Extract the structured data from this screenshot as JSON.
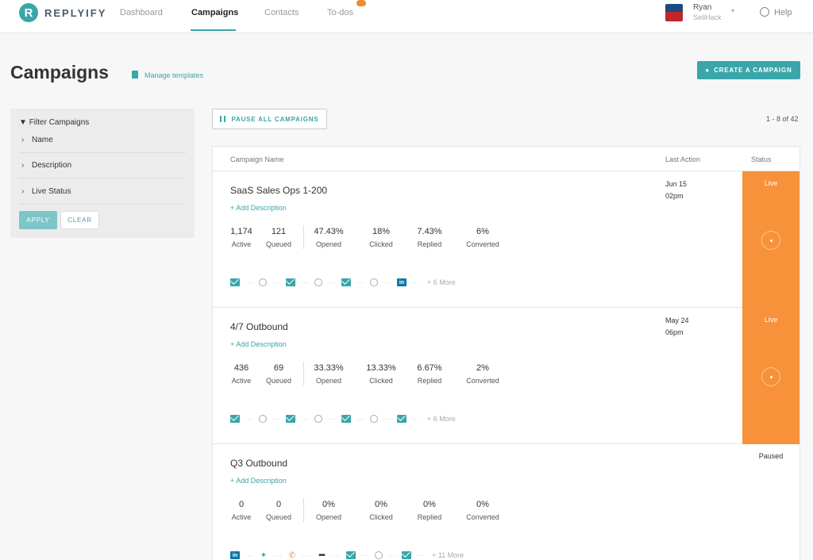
{
  "nav": {
    "brand": "REPLYIFY",
    "brand_mark": "R",
    "items": [
      "Dashboard",
      "Campaigns",
      "Contacts",
      "To-dos"
    ],
    "user_name": "Ryan",
    "user_org": "SellHack",
    "help": "Help"
  },
  "header": {
    "title": "Campaigns",
    "manage_templates": "Manage templates",
    "create_button": "CREATE A CAMPAIGN"
  },
  "filter": {
    "title": "Filter Campaigns",
    "rows": [
      "Name",
      "Description",
      "Live Status"
    ],
    "apply": "APPLY",
    "clear": "CLEAR"
  },
  "toolbar": {
    "pause_all": "PAUSE ALL CAMPAIGNS",
    "pagination": "1 - 8 of 42"
  },
  "table": {
    "headers": [
      "Campaign Name",
      "Last Action",
      "Status"
    ],
    "stat_labels": [
      "Active",
      "Queued",
      "Opened",
      "Clicked",
      "Replied",
      "Converted"
    ],
    "add_description": "+ Add Description",
    "rows": [
      {
        "name": "SaaS Sales Ops 1-200",
        "stats": [
          "1,174",
          "121",
          "47.43%",
          "18%",
          "7.43%",
          "6%"
        ],
        "last_action_date": "Jun 15",
        "last_action_time": "02pm",
        "status": "Live",
        "steps": [
          "mail-icon",
          "clock-icon",
          "mail-icon",
          "clock-icon",
          "mail-icon",
          "clock-icon",
          "linkedin-icon"
        ],
        "more": "+ 6 More"
      },
      {
        "name": "4/7 Outbound",
        "stats": [
          "436",
          "69",
          "33.33%",
          "13.33%",
          "6.67%",
          "2%"
        ],
        "last_action_date": "May 24",
        "last_action_time": "06pm",
        "status": "Live",
        "steps": [
          "mail-icon",
          "clock-icon",
          "mail-icon",
          "clock-icon",
          "mail-icon",
          "clock-icon",
          "mail-icon"
        ],
        "more": "+ 6 More"
      },
      {
        "name": "Q3 Outbound",
        "stats": [
          "0",
          "0",
          "0%",
          "0%",
          "0%",
          "0%"
        ],
        "last_action_date": "",
        "last_action_time": "",
        "status": "Paused",
        "steps": [
          "linkedin-icon",
          "twitter-icon",
          "phone-icon",
          "dots-icon",
          "mail-icon",
          "clock-icon",
          "mail-icon"
        ],
        "more": "+ 11 More"
      }
    ]
  },
  "colors": {
    "accent": "#3aa6a9",
    "live": "#f7923a",
    "linkedin": "#0e76a8"
  }
}
